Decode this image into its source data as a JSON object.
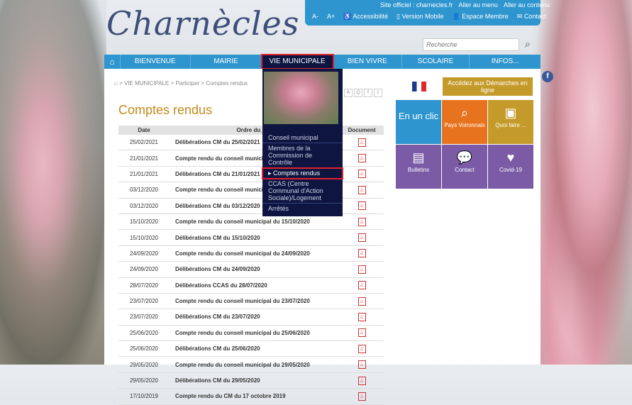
{
  "site": {
    "logo": "Charnècles",
    "top_links": [
      "Site officiel : charnecles.fr",
      "Aller au menu",
      "Aller au contenu"
    ],
    "tools": [
      "A-",
      "A+",
      "Accessibilité",
      "Version Mobile",
      "Espace Membre",
      "Contact"
    ],
    "search_placeholder": "Recherche"
  },
  "nav": [
    "BIENVENUE",
    "MAIRIE",
    "VIE MUNICIPALE",
    "BIEN VIVRE",
    "SCOLAIRE",
    "INFOS..."
  ],
  "dropdown": [
    "Conseil municipal",
    "Membres de la Commission de Contrôle",
    "Comptes rendus",
    "CCAS (Centre Communal d'Action Sociale)/Logement",
    "Arrêtés"
  ],
  "breadcrumb": "> VIE MUNICIPALE > Participer > Comptes rendus",
  "page_title": "Comptes rendus",
  "table": {
    "headers": [
      "Date",
      "Ordre du jour",
      "Document"
    ],
    "rows": [
      [
        "25/02/2021",
        "Délibérations CM du 25/02/2021"
      ],
      [
        "21/01/2021",
        "Compte rendu du conseil municipal du 21/01/2021"
      ],
      [
        "21/01/2021",
        "Délibérations CM du 21/01/2021"
      ],
      [
        "03/12/2020",
        "Compte rendu du conseil municipal du 03/12/2020"
      ],
      [
        "03/12/2020",
        "Délibérations CM du 03/12/2020"
      ],
      [
        "15/10/2020",
        "Compte rendu du conseil municipal du 15/10/2020"
      ],
      [
        "15/10/2020",
        "Délibérations CM du 15/10/2020"
      ],
      [
        "24/09/2020",
        "Compte rendu du conseil municipal du 24/09/2020"
      ],
      [
        "24/09/2020",
        "Délibérations CM du 24/09/2020"
      ],
      [
        "28/07/2020",
        "Délibérations CCAS du 28/07/2020"
      ],
      [
        "23/07/2020",
        "Compte rendu du conseil municipal du 23/07/2020"
      ],
      [
        "23/07/2020",
        "Délibérations CM du 23/07/2020"
      ],
      [
        "25/06/2020",
        "Compte rendu du conseil municipal du 25/06/2020"
      ],
      [
        "25/06/2020",
        "Délibérations CM du 25/06/2020"
      ],
      [
        "29/05/2020",
        "Compte rendu du conseil municipal du 29/05/2020"
      ],
      [
        "29/05/2020",
        "Délibérations CM du 29/05/2020"
      ],
      [
        "17/10/2019",
        "Compte rendu du CM du 17 octobre 2019"
      ]
    ]
  },
  "sidebar": {
    "demarches": "Accédez aux Démarches en ligne",
    "tiles": [
      {
        "label": "En un clic",
        "color": "#2e95cf"
      },
      {
        "label": "Pays Voironnais",
        "color": "#e8731f",
        "icon": "search-icon"
      },
      {
        "label": "Quoi faire ...",
        "color": "#c49b2a",
        "icon": "image-icon"
      },
      {
        "label": "Bulletins",
        "color": "#7b5aa6",
        "icon": "document-icon"
      },
      {
        "label": "Contact",
        "color": "#7b5aa6",
        "icon": "chat-icon"
      },
      {
        "label": "Covid-19",
        "color": "#7b5aa6",
        "icon": "heart-icon"
      }
    ]
  }
}
